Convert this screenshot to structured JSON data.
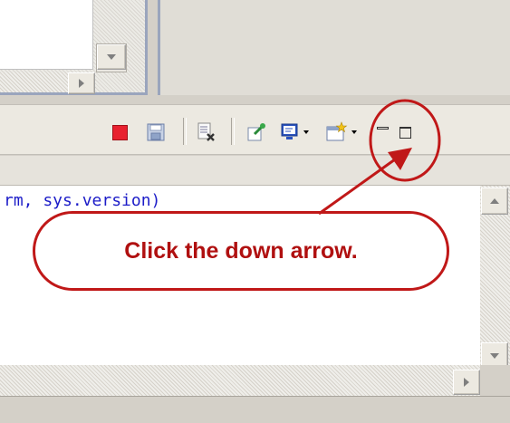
{
  "editor": {
    "code_text": "rm, sys.version)"
  },
  "annotation": {
    "callout_text": "Click the down arrow.",
    "color": "#c01818"
  },
  "toolbar": {
    "icons": [
      "stop-icon",
      "save-icon",
      "document-x-icon",
      "pin-icon",
      "monitor-icon",
      "chevron-down-icon",
      "new-window-icon",
      "chevron-down-icon",
      "minimize-icon",
      "maximize-icon"
    ]
  },
  "colors": {
    "code_blue": "#1c1cc8",
    "callout_red": "#b01010",
    "panel_border": "#9aa5bd"
  }
}
